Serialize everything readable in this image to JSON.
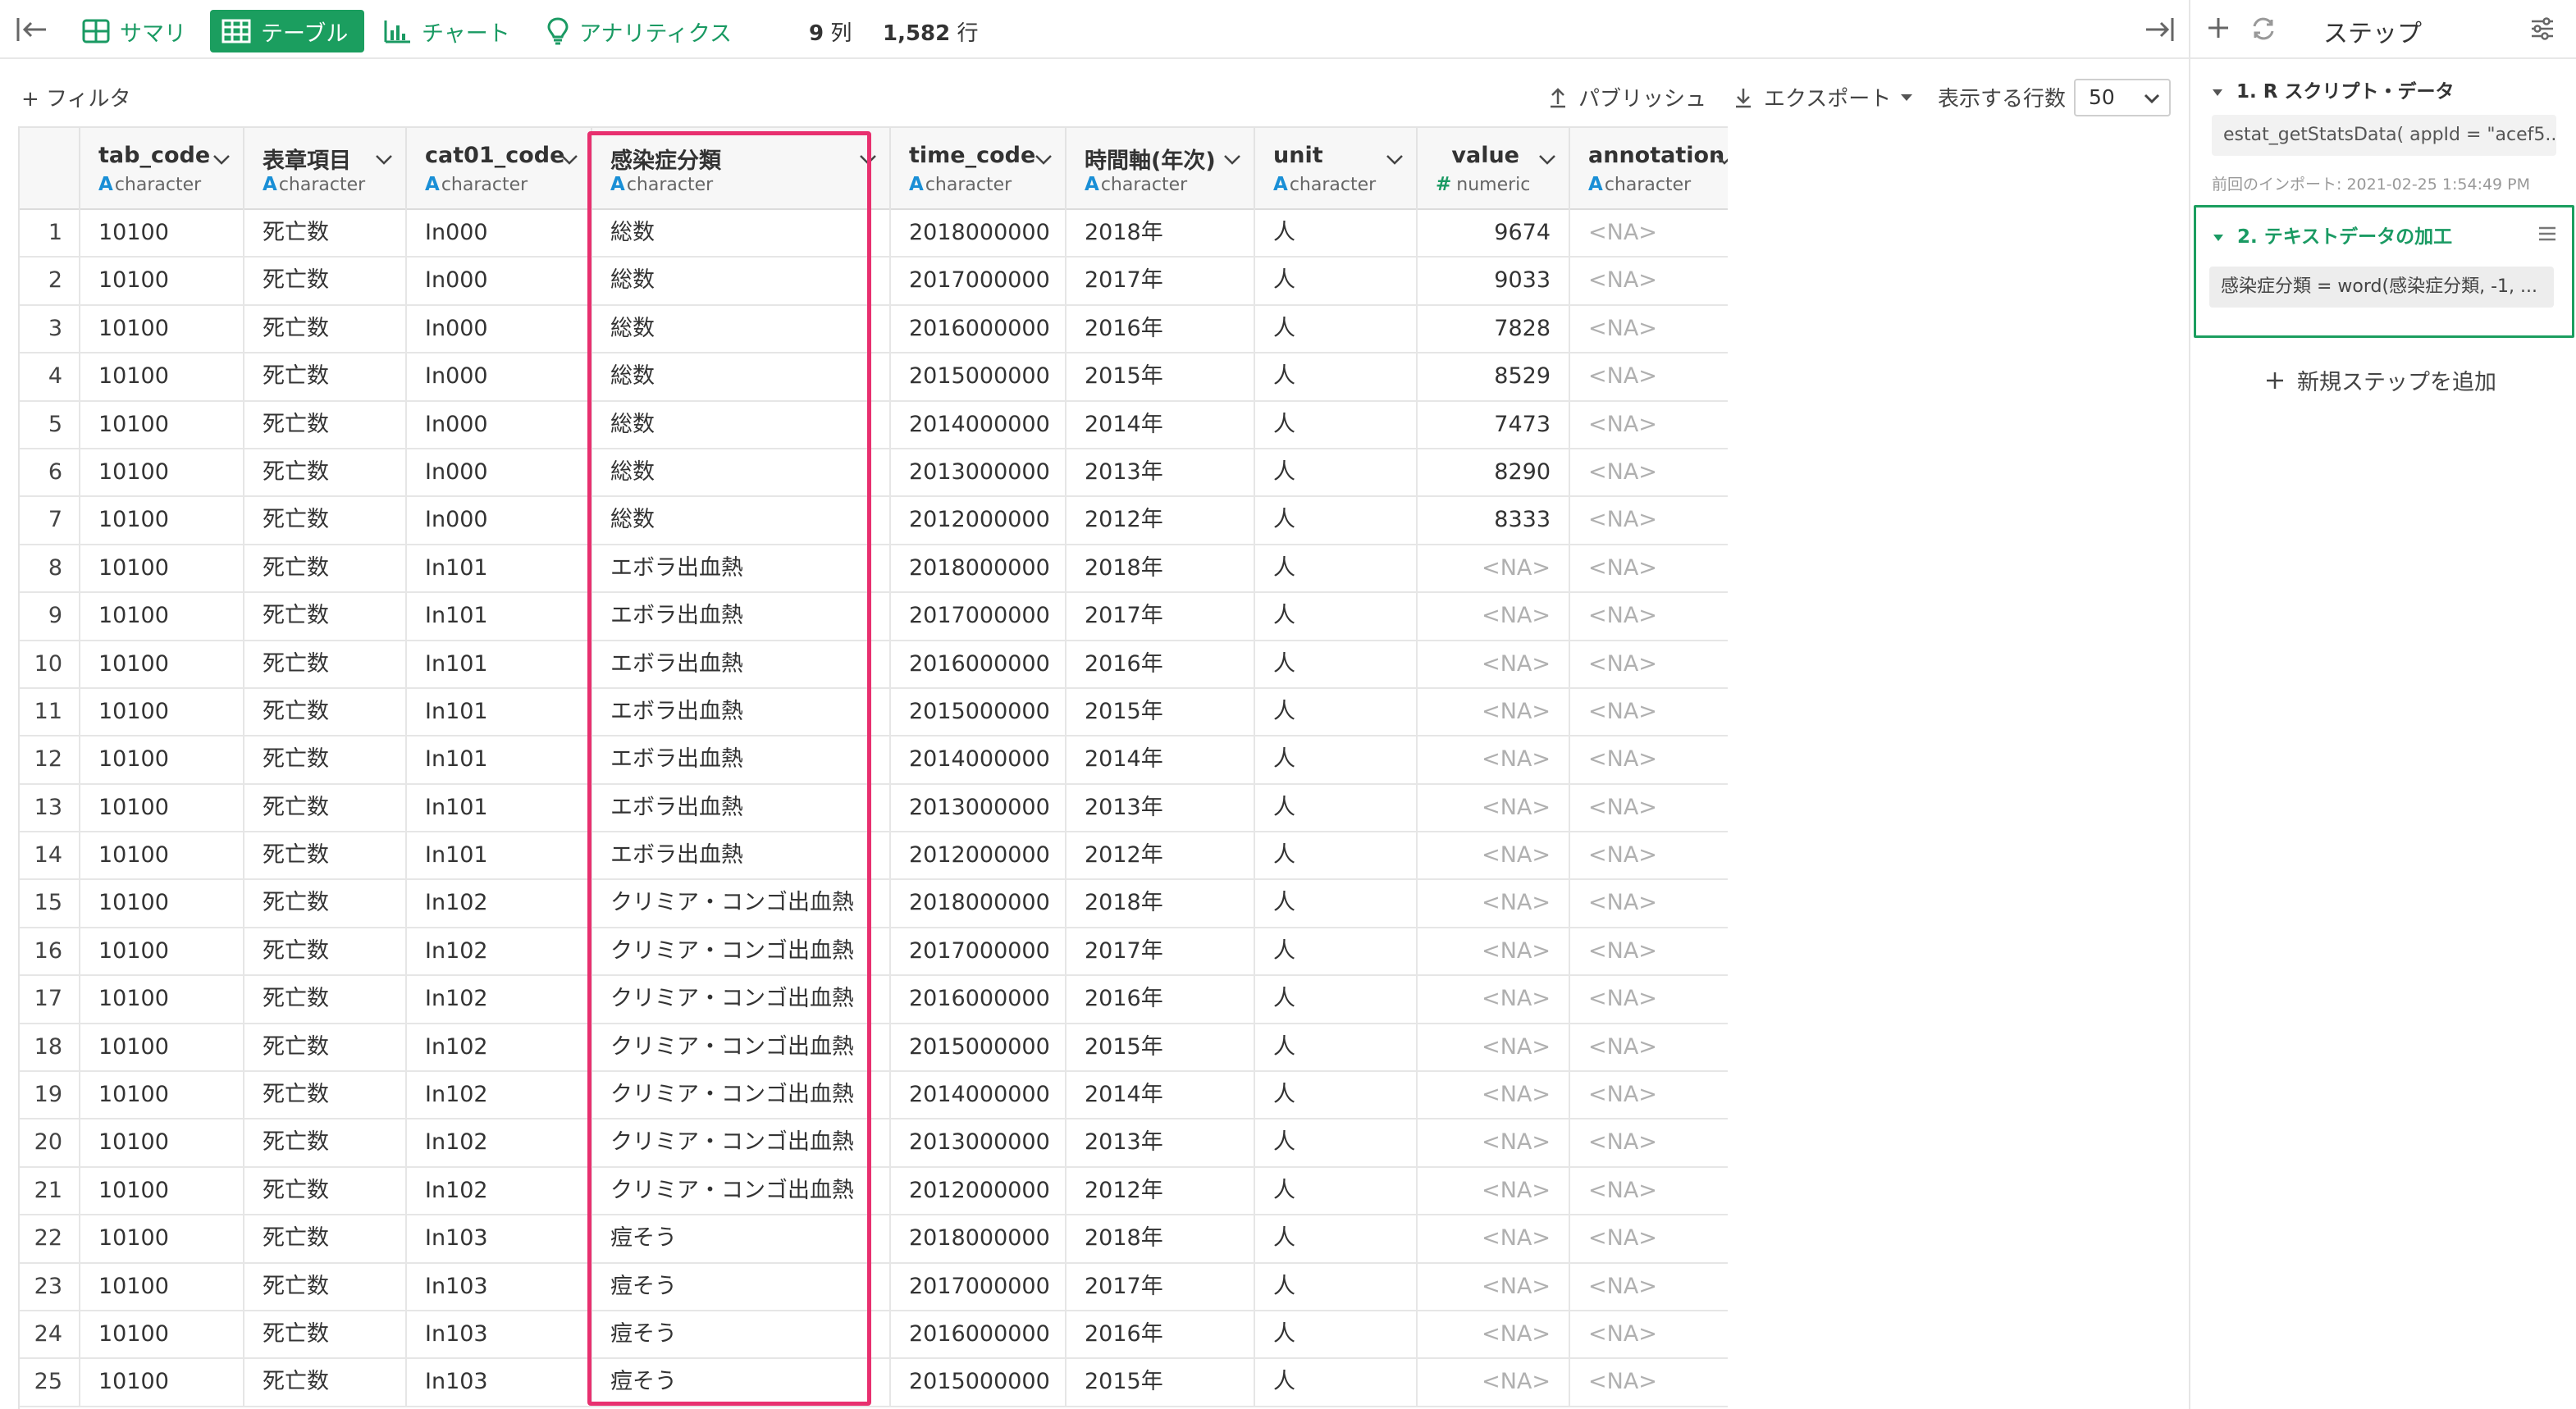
{
  "toolbar": {
    "tabs": [
      {
        "label": "サマリ",
        "icon": "summary-grid-icon"
      },
      {
        "label": "テーブル",
        "icon": "table-icon",
        "active": true
      },
      {
        "label": "チャート",
        "icon": "bar-chart-icon"
      },
      {
        "label": "アナリティクス",
        "icon": "lightbulb-icon"
      }
    ],
    "columns_count": "9",
    "columns_unit": "列",
    "rows_count": "1,582",
    "rows_unit": "行"
  },
  "subtoolbar": {
    "filter_label": "+ フィルタ",
    "publish_label": "パブリッシュ",
    "export_label": "エクスポート",
    "rows_label": "表示する行数",
    "rows_value": "50"
  },
  "table": {
    "columns": [
      {
        "name": "tab_code",
        "type": "character"
      },
      {
        "name": "表章項目",
        "type": "character"
      },
      {
        "name": "cat01_code",
        "type": "character"
      },
      {
        "name": "感染症分類",
        "type": "character"
      },
      {
        "name": "time_code",
        "type": "character"
      },
      {
        "name": "時間軸(年次)",
        "type": "character"
      },
      {
        "name": "unit",
        "type": "character"
      },
      {
        "name": "value",
        "type": "numeric"
      },
      {
        "name": "annotation",
        "type": "character"
      }
    ],
    "rows": [
      [
        "1",
        "10100",
        "死亡数",
        "In000",
        "総数",
        "2018000000",
        "2018年",
        "人",
        "9674",
        "<NA>"
      ],
      [
        "2",
        "10100",
        "死亡数",
        "In000",
        "総数",
        "2017000000",
        "2017年",
        "人",
        "9033",
        "<NA>"
      ],
      [
        "3",
        "10100",
        "死亡数",
        "In000",
        "総数",
        "2016000000",
        "2016年",
        "人",
        "7828",
        "<NA>"
      ],
      [
        "4",
        "10100",
        "死亡数",
        "In000",
        "総数",
        "2015000000",
        "2015年",
        "人",
        "8529",
        "<NA>"
      ],
      [
        "5",
        "10100",
        "死亡数",
        "In000",
        "総数",
        "2014000000",
        "2014年",
        "人",
        "7473",
        "<NA>"
      ],
      [
        "6",
        "10100",
        "死亡数",
        "In000",
        "総数",
        "2013000000",
        "2013年",
        "人",
        "8290",
        "<NA>"
      ],
      [
        "7",
        "10100",
        "死亡数",
        "In000",
        "総数",
        "2012000000",
        "2012年",
        "人",
        "8333",
        "<NA>"
      ],
      [
        "8",
        "10100",
        "死亡数",
        "In101",
        "エボラ出血熱",
        "2018000000",
        "2018年",
        "人",
        "<NA>",
        "<NA>"
      ],
      [
        "9",
        "10100",
        "死亡数",
        "In101",
        "エボラ出血熱",
        "2017000000",
        "2017年",
        "人",
        "<NA>",
        "<NA>"
      ],
      [
        "10",
        "10100",
        "死亡数",
        "In101",
        "エボラ出血熱",
        "2016000000",
        "2016年",
        "人",
        "<NA>",
        "<NA>"
      ],
      [
        "11",
        "10100",
        "死亡数",
        "In101",
        "エボラ出血熱",
        "2015000000",
        "2015年",
        "人",
        "<NA>",
        "<NA>"
      ],
      [
        "12",
        "10100",
        "死亡数",
        "In101",
        "エボラ出血熱",
        "2014000000",
        "2014年",
        "人",
        "<NA>",
        "<NA>"
      ],
      [
        "13",
        "10100",
        "死亡数",
        "In101",
        "エボラ出血熱",
        "2013000000",
        "2013年",
        "人",
        "<NA>",
        "<NA>"
      ],
      [
        "14",
        "10100",
        "死亡数",
        "In101",
        "エボラ出血熱",
        "2012000000",
        "2012年",
        "人",
        "<NA>",
        "<NA>"
      ],
      [
        "15",
        "10100",
        "死亡数",
        "In102",
        "クリミア・コンゴ出血熱",
        "2018000000",
        "2018年",
        "人",
        "<NA>",
        "<NA>"
      ],
      [
        "16",
        "10100",
        "死亡数",
        "In102",
        "クリミア・コンゴ出血熱",
        "2017000000",
        "2017年",
        "人",
        "<NA>",
        "<NA>"
      ],
      [
        "17",
        "10100",
        "死亡数",
        "In102",
        "クリミア・コンゴ出血熱",
        "2016000000",
        "2016年",
        "人",
        "<NA>",
        "<NA>"
      ],
      [
        "18",
        "10100",
        "死亡数",
        "In102",
        "クリミア・コンゴ出血熱",
        "2015000000",
        "2015年",
        "人",
        "<NA>",
        "<NA>"
      ],
      [
        "19",
        "10100",
        "死亡数",
        "In102",
        "クリミア・コンゴ出血熱",
        "2014000000",
        "2014年",
        "人",
        "<NA>",
        "<NA>"
      ],
      [
        "20",
        "10100",
        "死亡数",
        "In102",
        "クリミア・コンゴ出血熱",
        "2013000000",
        "2013年",
        "人",
        "<NA>",
        "<NA>"
      ],
      [
        "21",
        "10100",
        "死亡数",
        "In102",
        "クリミア・コンゴ出血熱",
        "2012000000",
        "2012年",
        "人",
        "<NA>",
        "<NA>"
      ],
      [
        "22",
        "10100",
        "死亡数",
        "In103",
        "痘そう",
        "2018000000",
        "2018年",
        "人",
        "<NA>",
        "<NA>"
      ],
      [
        "23",
        "10100",
        "死亡数",
        "In103",
        "痘そう",
        "2017000000",
        "2017年",
        "人",
        "<NA>",
        "<NA>"
      ],
      [
        "24",
        "10100",
        "死亡数",
        "In103",
        "痘そう",
        "2016000000",
        "2016年",
        "人",
        "<NA>",
        "<NA>"
      ],
      [
        "25",
        "10100",
        "死亡数",
        "In103",
        "痘そう",
        "2015000000",
        "2015年",
        "人",
        "<NA>",
        "<NA>"
      ]
    ],
    "highlight_color": "#e8306f"
  },
  "steps_panel": {
    "title": "ステップ",
    "steps": [
      {
        "title": "1. R スクリプト・データ",
        "code": "estat_getStatsData( appId = \"acef5...",
        "last_import": "前回のインポート: 2021-02-25 1:54:49 PM"
      },
      {
        "title": "2. テキストデータの加工",
        "code": "感染症分類 = word(感染症分類, -1, ...",
        "active": true
      }
    ],
    "add_step_label": "新規ステップを追加"
  },
  "colors": {
    "accent": "#1b9e5f",
    "highlight": "#e8306f",
    "type_character": "#1a8fd6"
  }
}
